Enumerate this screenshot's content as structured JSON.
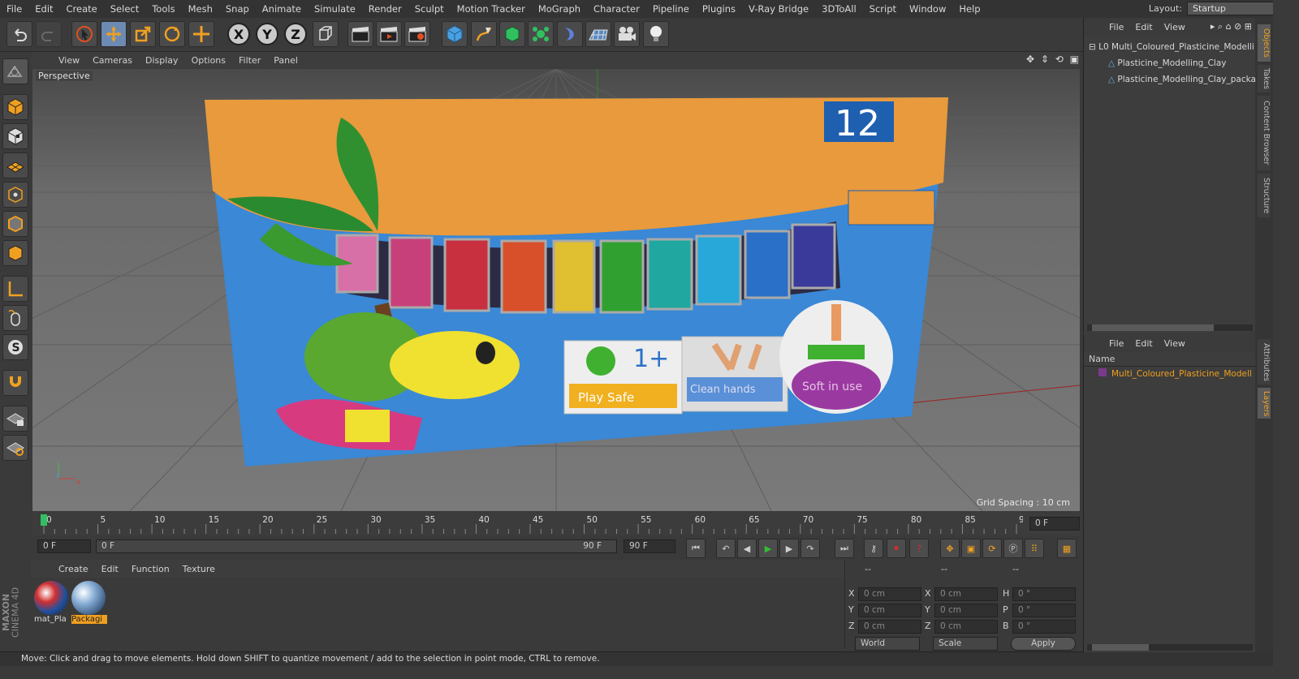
{
  "menubar": {
    "items": [
      "File",
      "Edit",
      "Create",
      "Select",
      "Tools",
      "Mesh",
      "Snap",
      "Animate",
      "Simulate",
      "Render",
      "Sculpt",
      "Motion Tracker",
      "MoGraph",
      "Character",
      "Pipeline",
      "Plugins",
      "V-Ray Bridge",
      "3DToAll",
      "Script",
      "Window",
      "Help"
    ],
    "layout_label": "Layout:",
    "layout_value": "Startup"
  },
  "viewport": {
    "menu": [
      "View",
      "Cameras",
      "Display",
      "Options",
      "Filter",
      "Panel"
    ],
    "camera": "Perspective",
    "grid_spacing": "Grid Spacing : 10 cm",
    "box": {
      "count_label": "12",
      "badge_age": "1+",
      "badge_play": "Play Safe",
      "badge_clean": "Clean hands",
      "badge_soft": "Soft in use"
    }
  },
  "timeline": {
    "ticks": [
      "0",
      "5",
      "10",
      "15",
      "20",
      "25",
      "30",
      "35",
      "40",
      "45",
      "50",
      "55",
      "60",
      "65",
      "70",
      "75",
      "80",
      "85",
      "90"
    ],
    "current_frame": "0 F"
  },
  "controls": {
    "start_field": "0 F",
    "slider_start": "0 F",
    "slider_end": "90 F",
    "end_field": "90 F"
  },
  "materials": {
    "menu": [
      "Create",
      "Edit",
      "Function",
      "Texture"
    ],
    "items": [
      {
        "name": "mat_Pla",
        "selected": false
      },
      {
        "name": "Packagi",
        "selected": true
      }
    ]
  },
  "coordinates": {
    "headers": [
      "--",
      "--",
      "--"
    ],
    "rows": [
      {
        "a": "X",
        "a_val": "0 cm",
        "b": "X",
        "b_val": "0 cm",
        "c": "H",
        "c_val": "0 °"
      },
      {
        "a": "Y",
        "a_val": "0 cm",
        "b": "Y",
        "b_val": "0 cm",
        "c": "P",
        "c_val": "0 °"
      },
      {
        "a": "Z",
        "a_val": "0 cm",
        "b": "Z",
        "b_val": "0 cm",
        "c": "B",
        "c_val": "0 °"
      }
    ],
    "world": "World",
    "scale": "Scale",
    "apply": "Apply"
  },
  "objects": {
    "menu": [
      "File",
      "Edit",
      "View"
    ],
    "items": [
      "Multi_Coloured_Plasticine_Modelli",
      "Plasticine_Modelling_Clay",
      "Plasticine_Modelling_Clay_packa"
    ]
  },
  "layers": {
    "menu": [
      "File",
      "Edit",
      "View"
    ],
    "header": "Name",
    "items": [
      "Multi_Coloured_Plasticine_Modell"
    ]
  },
  "side_tabs": [
    "Objects",
    "Takes",
    "Content Browser",
    "Structure",
    "Attributes",
    "Layers"
  ],
  "status": "Move: Click and drag to move elements. Hold down SHIFT to quantize movement / add to the selection in point mode, CTRL to remove.",
  "branding": {
    "line1": "MAXON",
    "line2": "CINEMA 4D"
  },
  "colors": {
    "accent": "#f0a020",
    "selection": "#6d8ab3",
    "layer_color": "#7a3a8a"
  }
}
